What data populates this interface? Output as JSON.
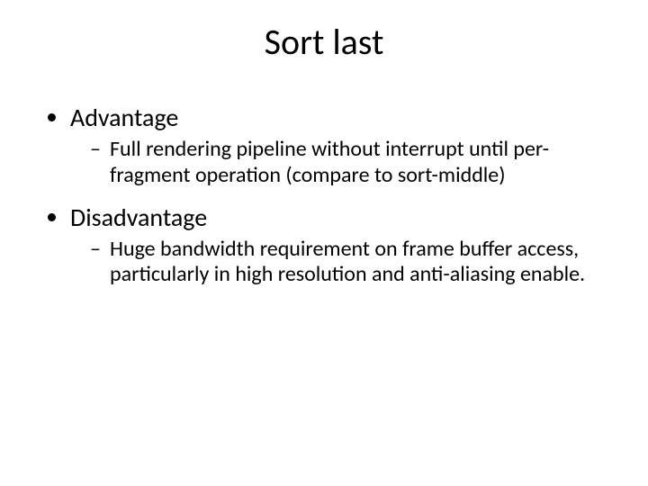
{
  "title": "Sort last",
  "bullets": [
    {
      "label": "Advantage",
      "sub": "Full rendering pipeline without interrupt until per-fragment operation (compare to sort-middle)"
    },
    {
      "label": "Disadvantage",
      "sub": "Huge bandwidth requirement on frame buffer access, particularly in high resolution and anti-aliasing enable."
    }
  ]
}
